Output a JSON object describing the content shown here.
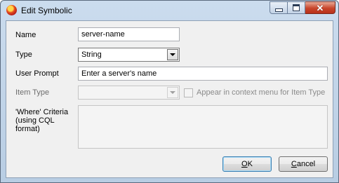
{
  "window": {
    "title": "Edit Symbolic"
  },
  "form": {
    "name_label": "Name",
    "name_value": "server-name",
    "type_label": "Type",
    "type_value": "String",
    "prompt_label": "User Prompt",
    "prompt_value": "Enter a server's name",
    "item_type_label": "Item Type",
    "item_type_value": "",
    "context_menu_label": "Appear in context menu for Item Type",
    "criteria_label_1": "'Where' Criteria",
    "criteria_label_2": "(using CQL",
    "criteria_label_3": "format)",
    "criteria_value": ""
  },
  "buttons": {
    "ok_mnemonic": "O",
    "ok_rest": "K",
    "cancel_mnemonic": "C",
    "cancel_rest": "ancel"
  }
}
